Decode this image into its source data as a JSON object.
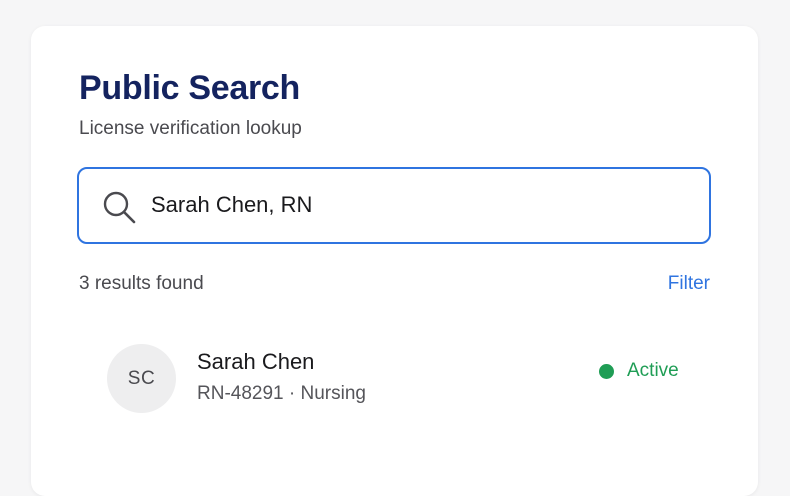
{
  "header": {
    "title": "Public Search",
    "subtitle": "License verification lookup"
  },
  "search": {
    "icon": "search-icon",
    "value": "Sarah Chen, RN"
  },
  "results": {
    "count_text": "3 results found",
    "filter_label": "Filter",
    "items": [
      {
        "initials": "SC",
        "name": "Sarah Chen",
        "meta": "RN-48291 · Nursing",
        "status": "Active",
        "status_color": "#1f9d55"
      }
    ]
  },
  "colors": {
    "accent": "#2f74e0",
    "title": "#14235f",
    "status_active": "#1f9d55"
  }
}
